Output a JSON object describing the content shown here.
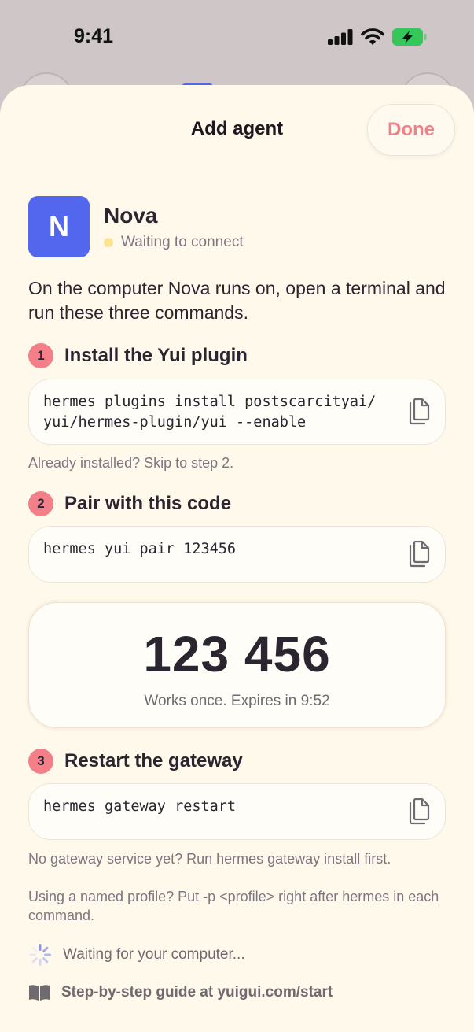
{
  "status_bar": {
    "time": "9:41"
  },
  "sheet": {
    "title": "Add agent",
    "done_label": "Done"
  },
  "agent": {
    "initial": "N",
    "name": "Nova",
    "status": "Waiting to connect"
  },
  "intro": "On the computer Nova runs on, open a terminal and run these three commands.",
  "steps": [
    {
      "number": "1",
      "title": "Install the Yui plugin",
      "command_line1": "hermes plugins install postscarcityai/",
      "command_line2": "yui/hermes-plugin/yui --enable",
      "hint": "Already installed? Skip to step 2."
    },
    {
      "number": "2",
      "title": "Pair with this code",
      "command": "hermes yui pair 123456",
      "pair_code": "123 456",
      "expires_text": "Works once. Expires in 9:52"
    },
    {
      "number": "3",
      "title": "Restart the gateway",
      "command": "hermes gateway restart",
      "hint": "No gateway service yet? Run hermes gateway install first."
    }
  ],
  "profile_hint": "Using a named profile? Put -p <profile> right after hermes in each command.",
  "waiting_text": "Waiting for your computer...",
  "guide_text": "Step-by-step guide at yuigui.com/start",
  "colors": {
    "accent": "#f37f88",
    "avatar": "#5366ee",
    "sheet_bg": "#fff9ec",
    "status_dot": "#fbe391"
  }
}
